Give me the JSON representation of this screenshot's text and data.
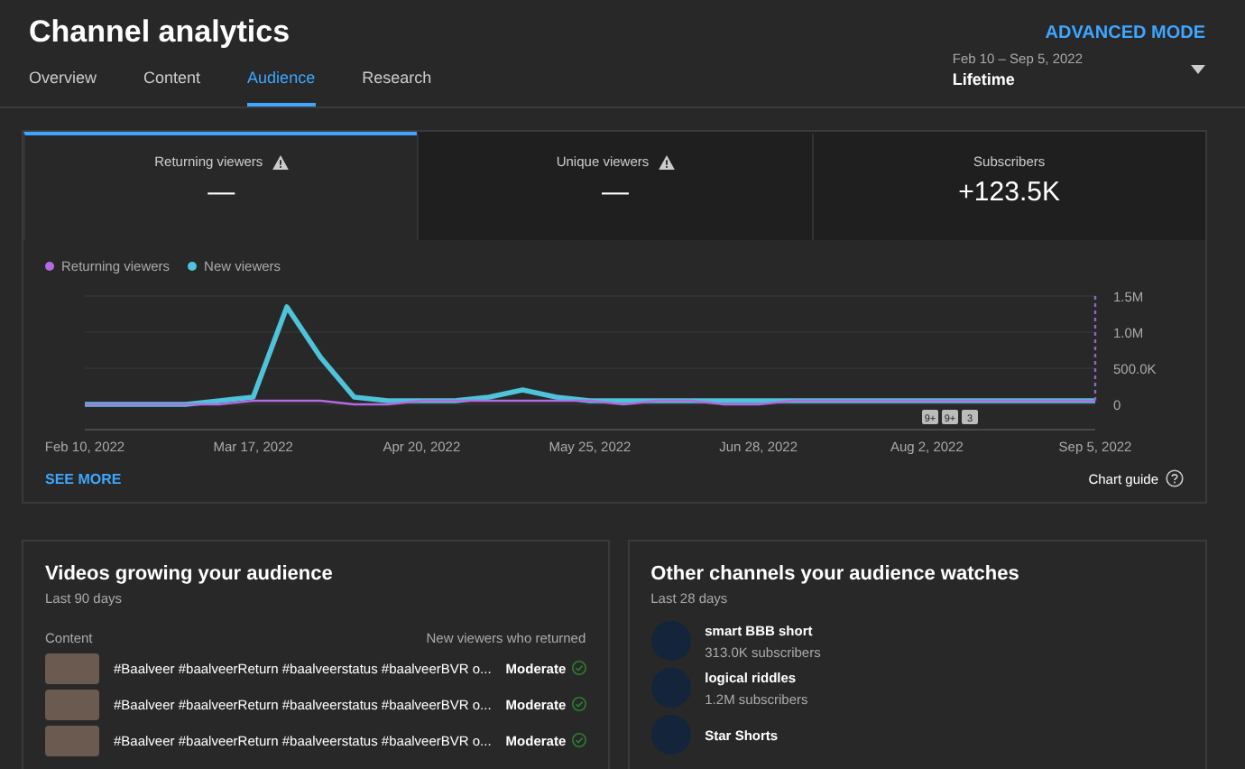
{
  "header": {
    "title": "Channel analytics",
    "advanced_mode": "ADVANCED MODE"
  },
  "tabs": [
    {
      "label": "Overview",
      "selected": false
    },
    {
      "label": "Content",
      "selected": false
    },
    {
      "label": "Audience",
      "selected": true
    },
    {
      "label": "Research",
      "selected": false
    }
  ],
  "date_range": {
    "range": "Feb 10 – Sep 5, 2022",
    "value": "Lifetime"
  },
  "metrics": [
    {
      "label": "Returning viewers",
      "value": "—",
      "warning": true,
      "selected": true
    },
    {
      "label": "Unique viewers",
      "value": "—",
      "warning": true,
      "selected": false
    },
    {
      "label": "Subscribers",
      "value": "+123.5K",
      "warning": false,
      "selected": false
    }
  ],
  "chart": {
    "chart_data": {
      "type": "line",
      "categories": [
        "Feb 10, 2022",
        null,
        null,
        null,
        null,
        "Mar 17, 2022",
        null,
        null,
        null,
        null,
        "Apr 20, 2022",
        null,
        null,
        null,
        null,
        "May 25, 2022",
        null,
        null,
        null,
        null,
        "Jun 28, 2022",
        null,
        null,
        null,
        null,
        "Aug 2, 2022",
        null,
        null,
        null,
        null,
        "Sep 5, 2022"
      ],
      "series": [
        {
          "name": "Returning viewers",
          "color": "#b36ae2",
          "values": [
            0,
            0,
            0,
            0,
            0,
            50000,
            50000,
            50000,
            0,
            0,
            50000,
            50000,
            50000,
            50000,
            50000,
            50000,
            0,
            50000,
            50000,
            0,
            0,
            50000,
            50000,
            50000,
            50000,
            50000,
            50000,
            50000,
            50000,
            50000,
            50000
          ]
        },
        {
          "name": "New viewers",
          "color": "#4fc3d9",
          "values": [
            0,
            0,
            0,
            0,
            50000,
            100000,
            1350000,
            650000,
            100000,
            50000,
            50000,
            50000,
            100000,
            200000,
            100000,
            50000,
            50000,
            50000,
            50000,
            50000,
            50000,
            50000,
            50000,
            50000,
            50000,
            50000,
            50000,
            50000,
            50000,
            50000,
            50000
          ]
        }
      ],
      "ylim": [
        0,
        1500000
      ],
      "yticks": [
        {
          "value": 0,
          "label": "0"
        },
        {
          "value": 500000,
          "label": "500.0K"
        },
        {
          "value": 1000000,
          "label": "1.0M"
        },
        {
          "value": 1500000,
          "label": "1.5M"
        }
      ]
    },
    "markers": [
      {
        "label": "9+"
      },
      {
        "label": "9+"
      },
      {
        "label": "3"
      }
    ],
    "see_more": "SEE MORE",
    "chart_guide": "Chart guide"
  },
  "videos_panel": {
    "title": "Videos growing your audience",
    "subtitle": "Last 90 days",
    "column_1": "Content",
    "column_2": "New viewers who returned",
    "rows": [
      {
        "title": "#Baalveer #baalveerReturn #baalveerstatus #baalveerBVR o...",
        "rating": "Moderate"
      },
      {
        "title": "#Baalveer #baalveerReturn #baalveerstatus #baalveerBVR o...",
        "rating": "Moderate"
      },
      {
        "title": "#Baalveer #baalveerReturn #baalveerstatus #baalveerBVR o...",
        "rating": "Moderate"
      }
    ]
  },
  "channels_panel": {
    "title": "Other channels your audience watches",
    "subtitle": "Last 28 days",
    "channels": [
      {
        "name": "smart BBB short",
        "subscribers": "313.0K subscribers"
      },
      {
        "name": "logical riddles",
        "subscribers": "1.2M subscribers"
      },
      {
        "name": "Star Shorts"
      }
    ]
  }
}
